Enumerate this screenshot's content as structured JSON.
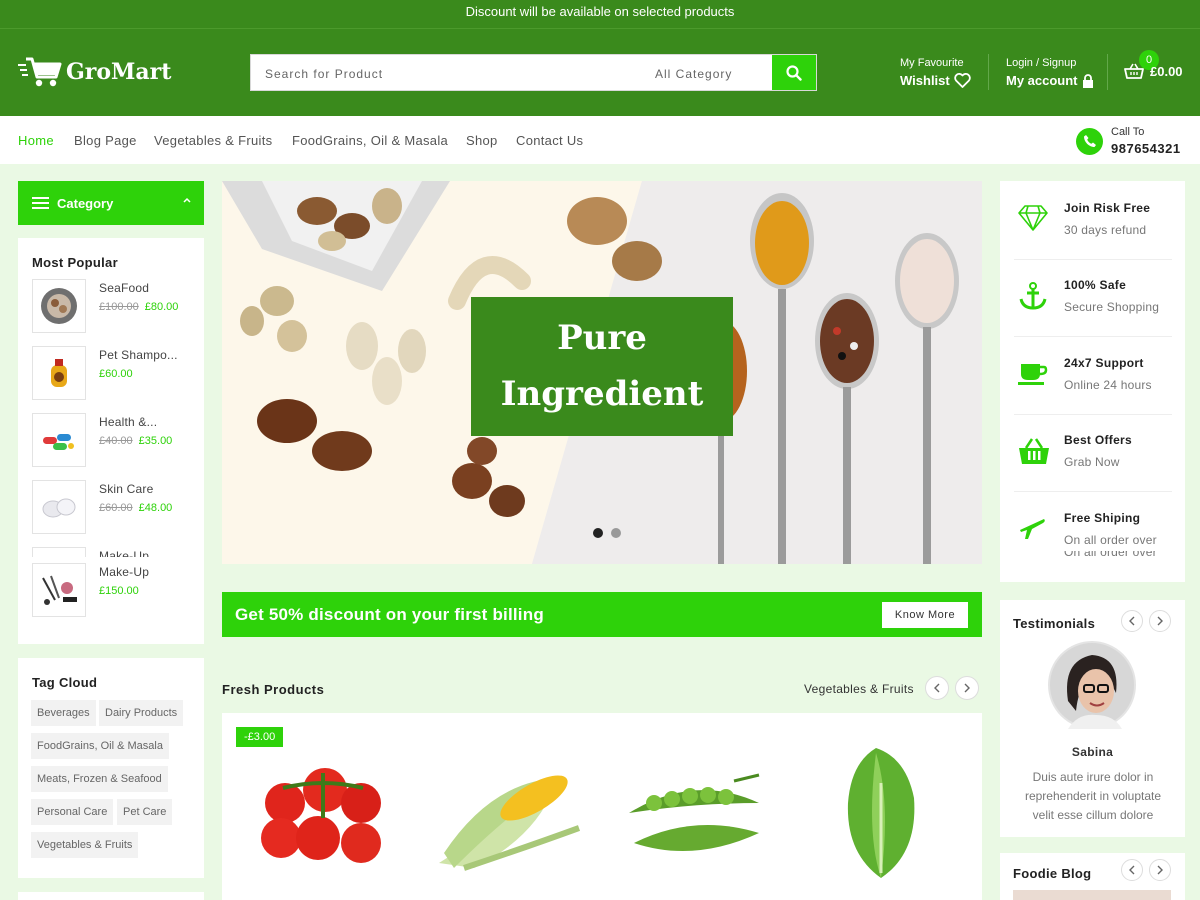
{
  "topbar": {
    "text": "Discount will be available on selected products"
  },
  "header": {
    "logo": "GroMart",
    "search_placeholder": "Search for Product",
    "search_category": "All Category",
    "favourite_label": "My Favourite",
    "wishlist_label": "Wishlist",
    "login_label": "Login / Signup",
    "account_label": "My account",
    "cart_count": "0",
    "cart_total": "£0.00"
  },
  "nav": {
    "items": [
      "Home",
      "Blog Page",
      "Vegetables & Fruits",
      "FoodGrains, Oil & Masala",
      "Shop",
      "Contact Us"
    ],
    "call_label": "Call To",
    "call_number": "987654321"
  },
  "sidebar": {
    "category_label": "Category",
    "most_popular_title": "Most Popular",
    "popular": [
      {
        "name": "SeaFood",
        "old_price": "£100.00",
        "price": "£80.00"
      },
      {
        "name": "Pet Shampo...",
        "old_price": "",
        "price": "£60.00"
      },
      {
        "name": "Health &...",
        "old_price": "£40.00",
        "price": "£35.00"
      },
      {
        "name": "Skin Care",
        "old_price": "£60.00",
        "price": "£48.00"
      },
      {
        "name": "Make-Up",
        "old_price": "",
        "price": "£150.00"
      }
    ],
    "popular_clipped_name": "Make-Up",
    "tag_cloud_title": "Tag Cloud",
    "tags": [
      "Beverages",
      "Dairy Products",
      "FoodGrains, Oil & Masala",
      "Meats, Frozen & Seafood",
      "Personal Care",
      "Pet Care",
      "Vegetables & Fruits"
    ]
  },
  "hero": {
    "title_line1": "Pure",
    "title_line2": "Ingredient",
    "active_slide": 1,
    "slide_count": 2
  },
  "promo": {
    "text": "Get 50% discount on your first billing",
    "button": "Know More"
  },
  "fresh": {
    "title": "Fresh Products",
    "tab": "Vegetables & Fruits",
    "sale_badge": "-£3.00",
    "products": [
      "tomato",
      "corn",
      "peas",
      "lettuce"
    ]
  },
  "features": [
    {
      "icon": "diamond-icon",
      "title": "Join Risk Free",
      "subtitle": "30 days refund"
    },
    {
      "icon": "anchor-icon",
      "title": "100% Safe",
      "subtitle": "Secure Shopping"
    },
    {
      "icon": "coffee-cup-icon",
      "title": "24x7 Support",
      "subtitle": "Online 24 hours"
    },
    {
      "icon": "basket-icon",
      "title": "Best Offers",
      "subtitle": "Grab Now"
    },
    {
      "icon": "airplane-icon",
      "title": "Free Shiping",
      "subtitle": "On all order over"
    }
  ],
  "features_clipped_subtitle": "On all order over",
  "testimonials": {
    "title": "Testimonials",
    "name": "Sabina",
    "text": "Duis aute irure dolor in reprehenderit in voluptate velit esse cillum dolore"
  },
  "blog": {
    "title": "Foodie Blog"
  },
  "colors": {
    "dark_green": "#3a8a1c",
    "bright_green": "#2ed20a",
    "page_bg": "#eaf9e4"
  }
}
